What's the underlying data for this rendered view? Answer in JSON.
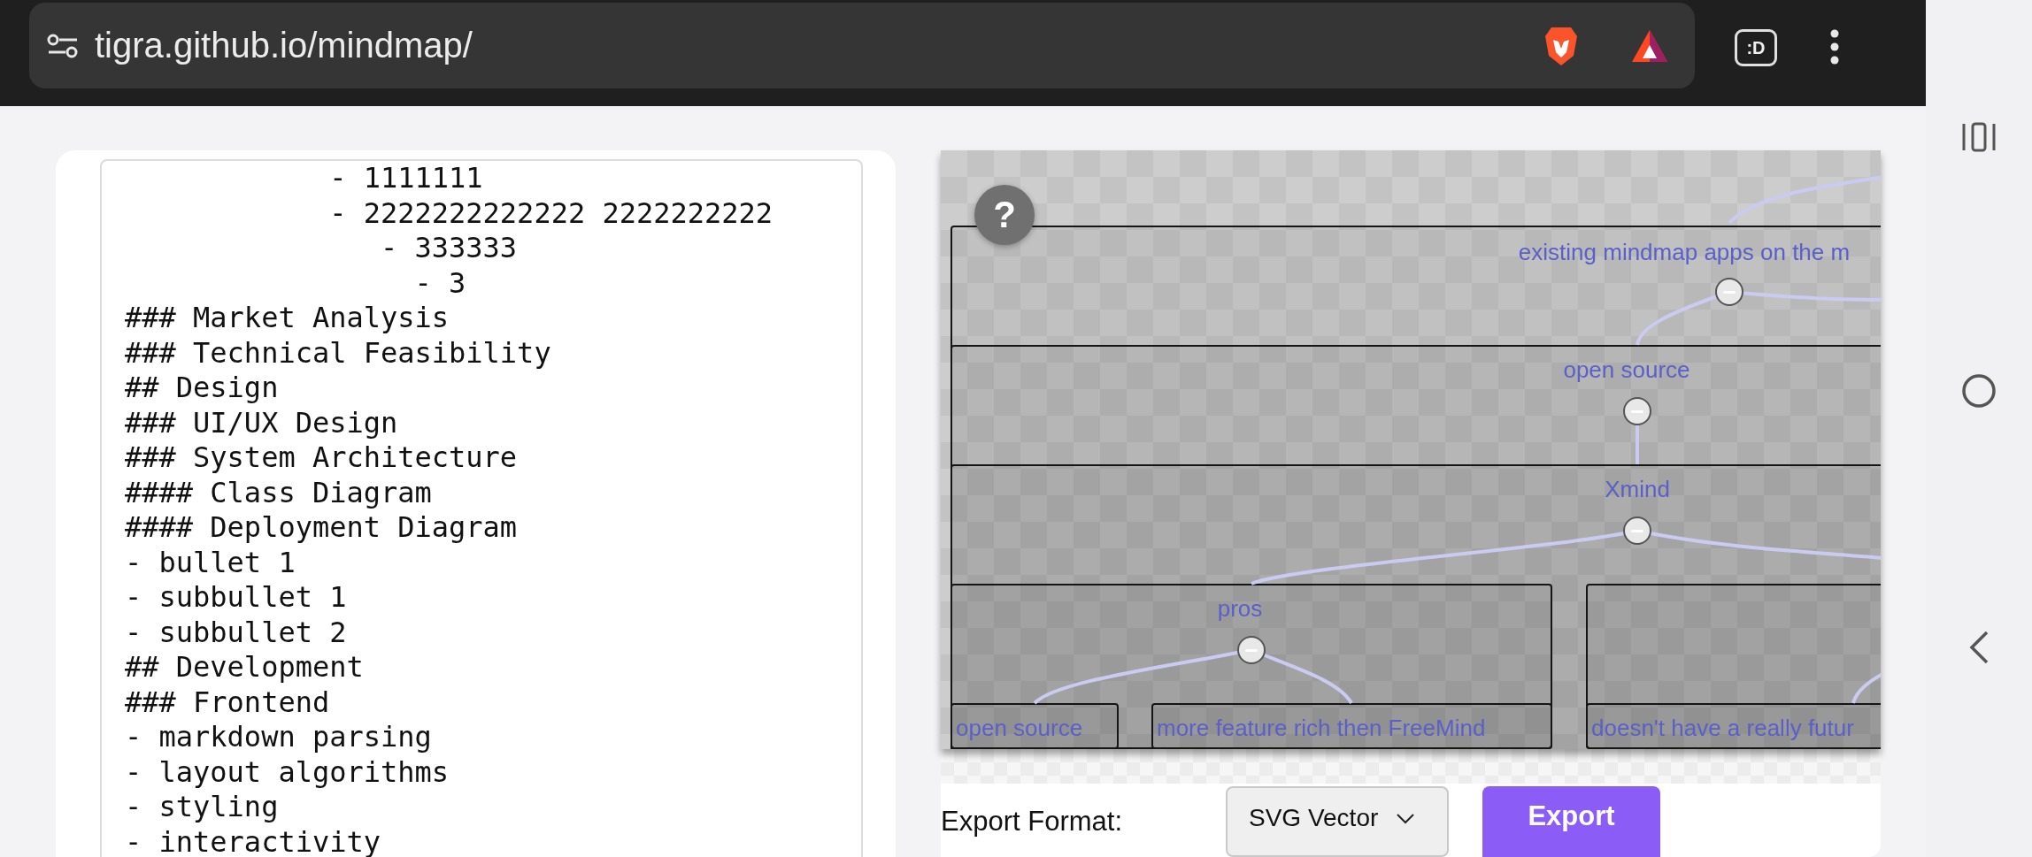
{
  "browser": {
    "url": "tigra.github.io/mindmap/",
    "tab_button": ":D"
  },
  "editor": {
    "lines": [
      "            - 1111111",
      "            - 2222222222222 2222222222",
      "               - 333333",
      "                 - 3",
      "### Market Analysis",
      "### Technical Feasibility",
      "## Design",
      "### UI/UX Design",
      "### System Architecture",
      "#### Class Diagram",
      "#### Deployment Diagram",
      "- bullet 1",
      "- subbullet 1",
      "- subbullet 2",
      "## Development",
      "### Frontend",
      "- markdown parsing",
      "- layout algorithms",
      "- styling",
      "- interactivity"
    ]
  },
  "mindmap": {
    "help_button": "?",
    "root": {
      "label": "existing mindmap apps on the m",
      "children": [
        {
          "label": "open source",
          "children": [
            {
              "label": "Xmind",
              "children": [
                {
                  "label": "pros",
                  "children": [
                    {
                      "label": "open source"
                    },
                    {
                      "label": "more feature rich then FreeMind"
                    }
                  ]
                },
                {
                  "children": [
                    {
                      "label": "doesn't have a really futur"
                    }
                  ]
                }
              ]
            }
          ]
        }
      ]
    }
  },
  "export": {
    "label": "Export Format:",
    "format": "SVG Vector",
    "button": "Export"
  }
}
